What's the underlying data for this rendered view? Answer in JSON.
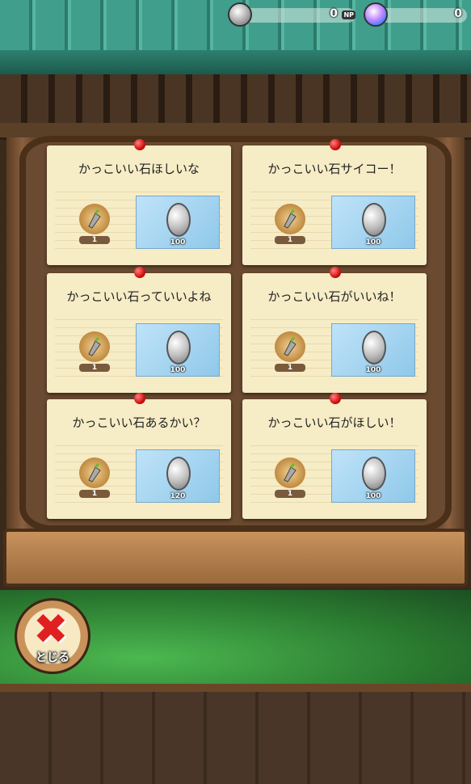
{
  "header": {
    "np": {
      "value": "0",
      "unit": "NP",
      "icon": "silver-coin-icon"
    },
    "gems": {
      "value": "0",
      "icon": "orb-gem-icon"
    }
  },
  "requests": [
    {
      "title": "かっこいい石ほしいな",
      "item_count": "1",
      "reward": "100"
    },
    {
      "title": "かっこいい石サイコー！",
      "item_count": "1",
      "reward": "100"
    },
    {
      "title": "かっこいい石っていいよね",
      "item_count": "1",
      "reward": "100"
    },
    {
      "title": "かっこいい石がいいね！",
      "item_count": "1",
      "reward": "100"
    },
    {
      "title": "かっこいい石あるかい？",
      "item_count": "1",
      "reward": "120"
    },
    {
      "title": "かっこいい石がほしい！",
      "item_count": "1",
      "reward": "100"
    }
  ],
  "close_button": {
    "label": "とじる",
    "icon": "red-x-icon"
  },
  "colors": {
    "pin": "#d01010",
    "close_x": "#e02020",
    "roof": "#3f9f8c"
  }
}
